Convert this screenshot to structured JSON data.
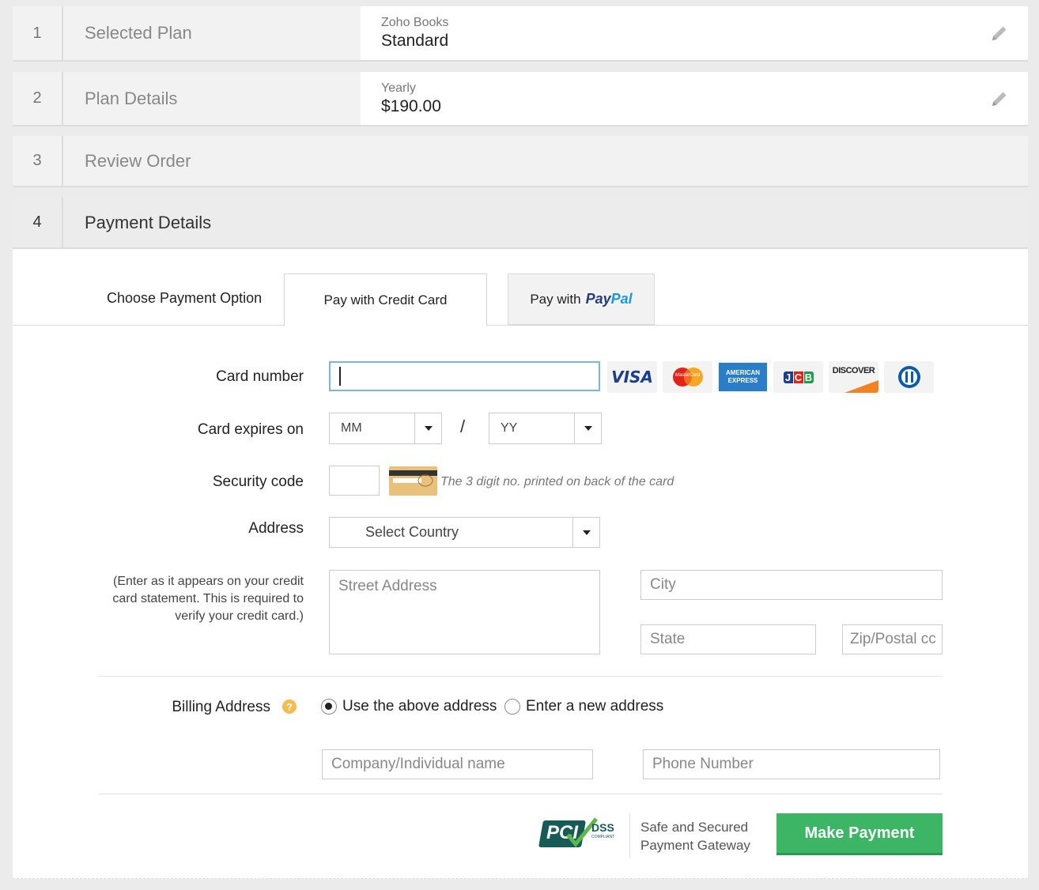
{
  "steps": [
    {
      "num": "1",
      "title": "Selected Plan",
      "sub": "Zoho Books",
      "main": "Standard"
    },
    {
      "num": "2",
      "title": "Plan Details",
      "sub": "Yearly",
      "main": "$190.00"
    },
    {
      "num": "3",
      "title": "Review Order"
    },
    {
      "num": "4",
      "title": "Payment Details"
    }
  ],
  "tabs": {
    "choose_label": "Choose Payment Option",
    "credit_card": "Pay with Credit Card",
    "paypal_prefix": "Pay with",
    "paypal_brand_1": "Pay",
    "paypal_brand_2": "Pal"
  },
  "form": {
    "card_number_label": "Card number",
    "card_expires_label": "Card expires on",
    "month_value": "MM",
    "year_value": "YY",
    "slash": "/",
    "security_code_label": "Security code",
    "security_hint": "The 3 digit no. printed on back of the card",
    "address_label": "Address",
    "country_value": "Select Country",
    "address_note": "(Enter as it appears on your credit card statement. This is required to verify your credit card.)",
    "street_placeholder": "Street Address",
    "city_placeholder": "City",
    "state_placeholder": "State",
    "zip_placeholder": "Zip/Postal cc",
    "billing_label": "Billing Address",
    "billing_help": "?",
    "radio_above": "Use the above address",
    "radio_new": "Enter a new address",
    "company_placeholder": "Company/Individual name",
    "phone_placeholder": "Phone Number"
  },
  "card_brands": [
    "visa-icon",
    "mastercard-icon",
    "amex-icon",
    "jcb-icon",
    "discover-icon",
    "diners-icon"
  ],
  "card_logo_text": {
    "visa": "VISA",
    "mastercard": "MasterCard",
    "amex_1": "AMERICAN",
    "amex_2": "EXPRESS",
    "jcb": "JCB",
    "discover": "DISCOVER"
  },
  "footer": {
    "pci_text": "PCI",
    "dss_text": "DSS",
    "pci_compliant": "COMPLIANT",
    "secure_line1": "Safe and Secured",
    "secure_line2": "Payment Gateway",
    "make_payment": "Make Payment"
  },
  "colors": {
    "accent_green": "#3cb664",
    "focus_blue": "#77b8de",
    "help_orange": "#f5bc4f",
    "paypal_dark": "#253b80",
    "paypal_light": "#179bd7"
  }
}
